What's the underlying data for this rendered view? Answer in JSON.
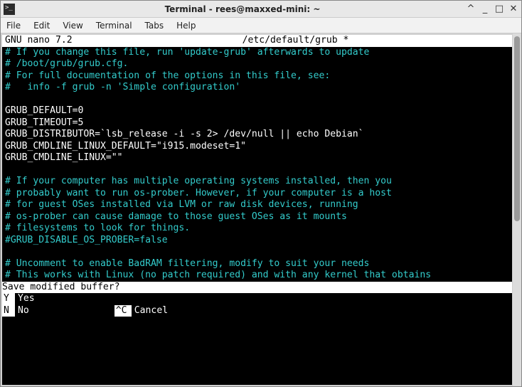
{
  "window": {
    "title": "Terminal - rees@maxxed-mini: ~"
  },
  "menu": {
    "file": "File",
    "edit": "Edit",
    "view": "View",
    "terminal": "Terminal",
    "tabs": "Tabs",
    "help": "Help"
  },
  "nano": {
    "app": "GNU nano 7.2",
    "filepath": "/etc/default/grub *",
    "prompt": "Save modified buffer?",
    "options": {
      "yes_key": "Y",
      "yes_label": "Yes",
      "no_key": "N",
      "no_label": "No",
      "cancel_key": "^C",
      "cancel_label": "Cancel"
    }
  },
  "file_lines": [
    {
      "style": "c",
      "text": "# If you change this file, run 'update-grub' afterwards to update"
    },
    {
      "style": "c",
      "text": "# /boot/grub/grub.cfg."
    },
    {
      "style": "c",
      "text": "# For full documentation of the options in this file, see:"
    },
    {
      "style": "c",
      "text": "#   info -f grub -n 'Simple configuration'"
    },
    {
      "style": "w",
      "text": ""
    },
    {
      "style": "w",
      "text": "GRUB_DEFAULT=0"
    },
    {
      "style": "w",
      "text": "GRUB_TIMEOUT=5"
    },
    {
      "style": "w",
      "text": "GRUB_DISTRIBUTOR=`lsb_release -i -s 2> /dev/null || echo Debian`"
    },
    {
      "style": "w",
      "text": "GRUB_CMDLINE_LINUX_DEFAULT=\"i915.modeset=1\""
    },
    {
      "style": "w",
      "text": "GRUB_CMDLINE_LINUX=\"\""
    },
    {
      "style": "w",
      "text": ""
    },
    {
      "style": "c",
      "text": "# If your computer has multiple operating systems installed, then you"
    },
    {
      "style": "c",
      "text": "# probably want to run os-prober. However, if your computer is a host"
    },
    {
      "style": "c",
      "text": "# for guest OSes installed via LVM or raw disk devices, running"
    },
    {
      "style": "c",
      "text": "# os-prober can cause damage to those guest OSes as it mounts"
    },
    {
      "style": "c",
      "text": "# filesystems to look for things."
    },
    {
      "style": "c",
      "text": "#GRUB_DISABLE_OS_PROBER=false"
    },
    {
      "style": "w",
      "text": ""
    },
    {
      "style": "c",
      "text": "# Uncomment to enable BadRAM filtering, modify to suit your needs"
    },
    {
      "style": "c",
      "text": "# This works with Linux (no patch required) and with any kernel that obtains"
    }
  ]
}
